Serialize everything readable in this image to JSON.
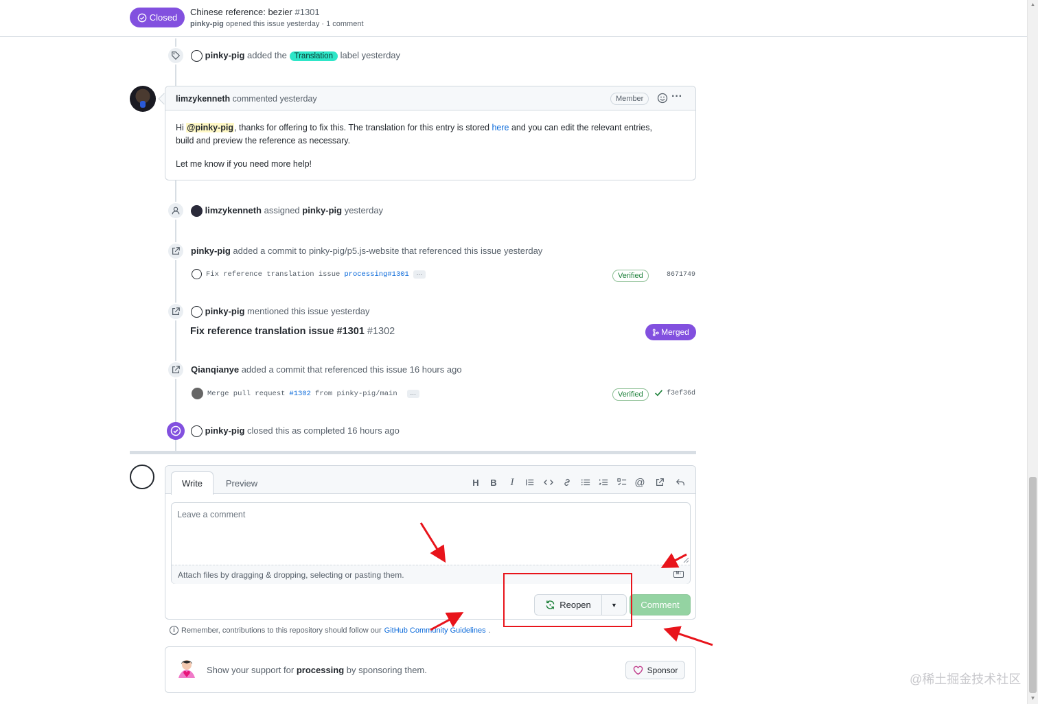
{
  "header": {
    "status_label": "Closed",
    "issue_title": "Chinese reference: bezier",
    "issue_number": "#1301",
    "author": "pinky-pig",
    "meta_rest": "opened this issue yesterday · 1 comment"
  },
  "timeline": {
    "label_event": {
      "actor": "pinky-pig",
      "pre": "added the",
      "label": "Translation",
      "post": "label yesterday",
      "label_color": "#2ee6c8"
    },
    "comment": {
      "author": "limzykenneth",
      "time": "commented yesterday",
      "badge": "Member",
      "body_hi": "Hi",
      "mention": "@pinky-pig",
      "body_mid": ", thanks for offering to fix this. The translation for this entry is stored",
      "link": "here",
      "body_end": "and you can edit the relevant entries,",
      "body_line2": "build and preview the reference as necessary.",
      "body_p2": "Let me know if you need more help!"
    },
    "assign_event": {
      "actor": "limzykenneth",
      "verb": "assigned",
      "target": "pinky-pig",
      "time": "yesterday"
    },
    "commit_event_1": {
      "actor": "pinky-pig",
      "text": "added a commit to pinky-pig/p5.js-website that referenced this issue yesterday",
      "commit_msg": "Fix reference translation issue",
      "commit_link": "processing#1301",
      "more": "…",
      "verified": "Verified",
      "sha": "8671749"
    },
    "mention_event": {
      "actor": "pinky-pig",
      "text": "mentioned this issue yesterday",
      "pr_title": "Fix reference translation issue #1301",
      "pr_number": "#1302",
      "merged_label": "Merged"
    },
    "commit_event_2": {
      "actor": "Qianqianye",
      "text": "added a commit that referenced this issue 16 hours ago",
      "commit_msg_pre": "Merge pull request",
      "commit_link": "#1302",
      "commit_msg_post": "from pinky-pig/main",
      "more": "…",
      "verified": "Verified",
      "sha": "f3ef36d"
    },
    "close_event": {
      "actor": "pinky-pig",
      "text": "closed this as completed 16 hours ago"
    }
  },
  "editor": {
    "tab_write": "Write",
    "tab_preview": "Preview",
    "placeholder": "Leave a comment",
    "attach_text": "Attach files by dragging & dropping, selecting or pasting them.",
    "reopen_label": "Reopen",
    "comment_label": "Comment",
    "toolbar": [
      "heading-icon",
      "bold-icon",
      "italic-icon",
      "quote-icon",
      "code-icon",
      "link-icon",
      "unordered-list-icon",
      "ordered-list-icon",
      "task-list-icon",
      "mention-icon",
      "cross-reference-icon",
      "reply-icon"
    ]
  },
  "guidelines": {
    "pre": "Remember, contributions to this repository should follow our",
    "link": "GitHub Community Guidelines",
    "post": "."
  },
  "sponsor": {
    "pre": "Show your support for",
    "org": "processing",
    "post": "by sponsoring them.",
    "button": "Sponsor"
  },
  "watermark": "@稀土掘金技术社区",
  "colors": {
    "accent_purple": "#8250df",
    "link_blue": "#0969da",
    "verified_green": "#1a7f37",
    "annotation_red": "#e8141b"
  }
}
